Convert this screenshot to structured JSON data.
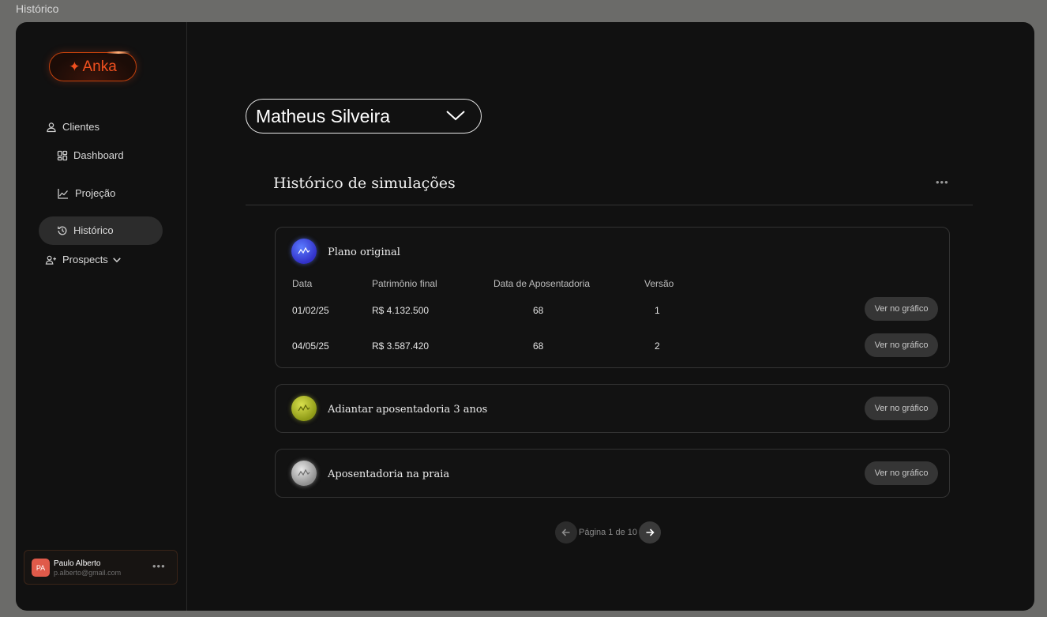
{
  "frame_title": "Histórico",
  "brand": {
    "name": "Anka",
    "accent": "#f0501f"
  },
  "sidebar": {
    "clients_label": "Clientes",
    "items": [
      {
        "label": "Dashboard",
        "icon": "dashboard-icon"
      },
      {
        "label": "Projeção",
        "icon": "chart-line-icon"
      },
      {
        "label": "Histórico",
        "icon": "history-icon",
        "active": true
      }
    ],
    "prospects_label": "Prospects"
  },
  "user": {
    "initials": "PA",
    "name": "Paulo Alberto",
    "email": "p.alberto@gmail.com"
  },
  "client_select": {
    "value": "Matheus Silveira"
  },
  "section": {
    "title": "Histórico de simulações"
  },
  "table_headers": [
    "Data",
    "Patrimônio final",
    "Data de Aposentadoria",
    "Versão"
  ],
  "simulations": [
    {
      "name": "Plano original",
      "color": "#3b46e0",
      "rows": [
        {
          "date": "01/02/25",
          "patrimonio": "R$ 4.132.500",
          "aposentadoria": "68",
          "versao": "1",
          "action": "Ver no gráfico"
        },
        {
          "date": "04/05/25",
          "patrimonio": "R$ 3.587.420",
          "aposentadoria": "68",
          "versao": "2",
          "action": "Ver no gráfico"
        }
      ]
    },
    {
      "name": "Adiantar aposentadoria 3 anos",
      "color": "#b5c21f",
      "action": "Ver no gráfico"
    },
    {
      "name": "Aposentadoria na praia",
      "color": "#c8c8c8",
      "action": "Ver no gráfico"
    }
  ],
  "pagination": {
    "label": "Página 1 de 10"
  }
}
